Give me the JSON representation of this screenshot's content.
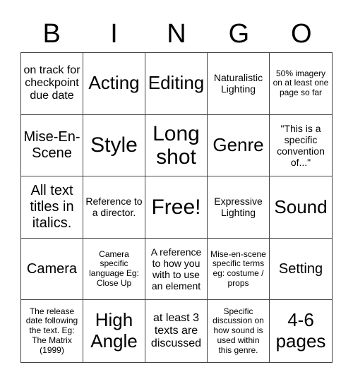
{
  "header": {
    "letters": [
      "B",
      "I",
      "N",
      "G",
      "O"
    ]
  },
  "cells": [
    {
      "text": "on track for checkpoint due date",
      "size": "s-md"
    },
    {
      "text": "Acting",
      "size": "s-xl"
    },
    {
      "text": "Editing",
      "size": "s-xl"
    },
    {
      "text": "Naturalistic Lighting",
      "size": "s-sm"
    },
    {
      "text": "50% imagery on at least one page so far",
      "size": "s-xs"
    },
    {
      "text": "Mise-En-Scene",
      "size": "s-lg"
    },
    {
      "text": "Style",
      "size": "s-xxl"
    },
    {
      "text": "Long shot",
      "size": "s-xxl"
    },
    {
      "text": "Genre",
      "size": "s-xl"
    },
    {
      "text": "\"This is a specific convention of...\"",
      "size": "s-sm"
    },
    {
      "text": "All text titles in italics.",
      "size": "s-lg"
    },
    {
      "text": "Reference to a director.",
      "size": "s-sm"
    },
    {
      "text": "Free!",
      "size": "s-xxl"
    },
    {
      "text": "Expressive Lighting",
      "size": "s-sm"
    },
    {
      "text": "Sound",
      "size": "s-xl"
    },
    {
      "text": "Camera",
      "size": "s-lg"
    },
    {
      "text": "Camera specific language Eg: Close Up",
      "size": "s-xs"
    },
    {
      "text": "A reference to how you with to use an element",
      "size": "s-sm"
    },
    {
      "text": "Mise-en-scene specific terms eg: costume / props",
      "size": "s-xs"
    },
    {
      "text": "Setting",
      "size": "s-lg"
    },
    {
      "text": "The release date following the text. Eg: The Matrix (1999)",
      "size": "s-xs"
    },
    {
      "text": "High Angle",
      "size": "s-xl"
    },
    {
      "text": "at least 3 texts are discussed",
      "size": "s-md"
    },
    {
      "text": "Specific discussion on how sound is used within this genre.",
      "size": "s-xs"
    },
    {
      "text": "4-6 pages",
      "size": "s-xl"
    }
  ]
}
